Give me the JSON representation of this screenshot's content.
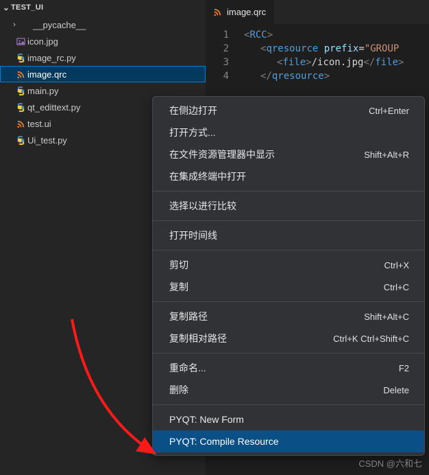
{
  "explorer": {
    "section_title": "TEST_UI",
    "items": [
      {
        "kind": "folder",
        "label": "__pycache__",
        "icon": "folder-icon"
      },
      {
        "kind": "file",
        "label": "icon.jpg",
        "icon": "image-icon"
      },
      {
        "kind": "file",
        "label": "image_rc.py",
        "icon": "python-icon"
      },
      {
        "kind": "file",
        "label": "image.qrc",
        "icon": "rss-icon",
        "selected": true
      },
      {
        "kind": "file",
        "label": "main.py",
        "icon": "python-icon"
      },
      {
        "kind": "file",
        "label": "qt_edittext.py",
        "icon": "python-icon"
      },
      {
        "kind": "file",
        "label": "test.ui",
        "icon": "rss-icon"
      },
      {
        "kind": "file",
        "label": "Ui_test.py",
        "icon": "python-icon"
      }
    ]
  },
  "editor": {
    "tab": {
      "label": "image.qrc",
      "icon": "rss-icon"
    },
    "lines": {
      "n1": "1",
      "n2": "2",
      "n3": "3",
      "n4": "4"
    },
    "code": {
      "rcc_open": "RCC",
      "qres_tag": "qresource",
      "qres_attr": "prefix",
      "qres_val": "GROUP",
      "file_tag": "file",
      "file_text": "/icon.jpg",
      "lt": "<",
      "gt": ">",
      "sl": "</",
      "eq": "=",
      "q": "\""
    }
  },
  "context_menu": {
    "items": [
      {
        "label": "在侧边打开",
        "shortcut": "Ctrl+Enter"
      },
      {
        "label": "打开方式...",
        "shortcut": ""
      },
      {
        "label": "在文件资源管理器中显示",
        "shortcut": "Shift+Alt+R"
      },
      {
        "label": "在集成终端中打开",
        "shortcut": ""
      },
      {
        "sep": true
      },
      {
        "label": "选择以进行比较",
        "shortcut": ""
      },
      {
        "sep": true
      },
      {
        "label": "打开时间线",
        "shortcut": ""
      },
      {
        "sep": true
      },
      {
        "label": "剪切",
        "shortcut": "Ctrl+X"
      },
      {
        "label": "复制",
        "shortcut": "Ctrl+C"
      },
      {
        "sep": true
      },
      {
        "label": "复制路径",
        "shortcut": "Shift+Alt+C"
      },
      {
        "label": "复制相对路径",
        "shortcut": "Ctrl+K Ctrl+Shift+C"
      },
      {
        "sep": true
      },
      {
        "label": "重命名...",
        "shortcut": "F2"
      },
      {
        "label": "删除",
        "shortcut": "Delete"
      },
      {
        "sep": true
      },
      {
        "label": "PYQT: New Form",
        "shortcut": ""
      },
      {
        "label": "PYQT: Compile Resource",
        "shortcut": "",
        "highlight": true
      }
    ]
  },
  "watermark": "CSDN @六和七",
  "icons": {
    "rss_color": "#e37933",
    "python_color": "#3572A5",
    "image_color": "#a074c4"
  }
}
